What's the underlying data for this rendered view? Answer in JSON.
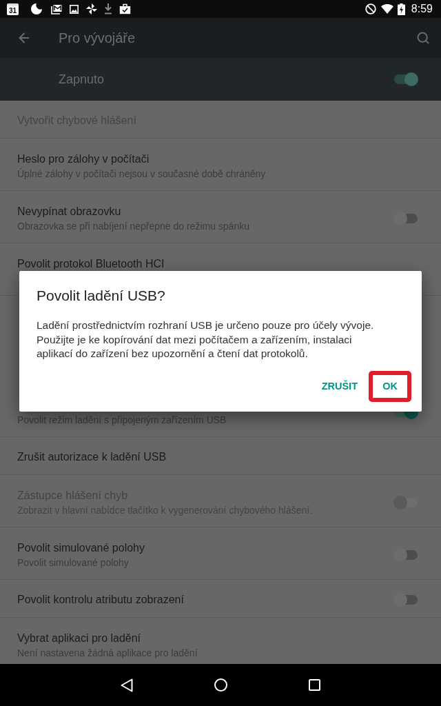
{
  "status_bar": {
    "calendar_day": "31",
    "time": "8:59"
  },
  "app_bar": {
    "title": "Pro vývojáře"
  },
  "master_switch": {
    "label": "Zapnuto",
    "on": true
  },
  "settings": [
    {
      "kind": "single",
      "title": "Vytvořit chybové hlášení",
      "disabled": true
    },
    {
      "kind": "double",
      "title": "Heslo pro zálohy v počítači",
      "subtitle": "Úplné zálohy v počítači nejsou v současné době chráněny",
      "disabled": false
    },
    {
      "kind": "double",
      "title": "Nevypínat obrazovku",
      "subtitle": "Obrazovka se při nabíjení nepřepne do režimu spánku",
      "disabled": false,
      "switch": {
        "on": false
      }
    },
    {
      "kind": "double",
      "title": "Povolit protokol Bluetooth HCI",
      "disabled": false
    },
    {
      "kind": "covered"
    },
    {
      "kind": "double",
      "subtitle": "Povolit režim ladění s připojeným zařízením USB",
      "disabled": false,
      "switch": {
        "on": true
      }
    },
    {
      "kind": "single",
      "title": "Zrušit autorizace k ladění USB",
      "disabled": false
    },
    {
      "kind": "double",
      "title": "Zástupce hlášení chyb",
      "subtitle": "Zobrazit v hlavní nabídce tlačítko k vygenerování chybového hlášení.",
      "disabled": true,
      "switch": {
        "on": false
      }
    },
    {
      "kind": "double",
      "title": "Povolit simulované polohy",
      "subtitle": "Povolit simulované polohy",
      "disabled": false,
      "switch": {
        "on": false
      }
    },
    {
      "kind": "single",
      "title": "Povolit kontrolu atributu zobrazení",
      "disabled": false,
      "switch": {
        "on": false
      }
    },
    {
      "kind": "double",
      "title": "Vybrat aplikaci pro ladění",
      "subtitle": "Není nastavena žádná aplikace pro ladění",
      "disabled": false
    }
  ],
  "dialog": {
    "title": "Povolit ladění USB?",
    "message": "Ladění prostřednictvím rozhraní USB je určeno pouze pro účely vývoje. Použijte je ke kopírování dat mezi počítačem a zařízením, instalaci aplikací do zařízení bez upozornění a čtení dat protokolů.",
    "buttons": [
      {
        "label": "ZRUŠIT",
        "highlighted": false
      },
      {
        "label": "OK",
        "highlighted": true
      }
    ]
  }
}
